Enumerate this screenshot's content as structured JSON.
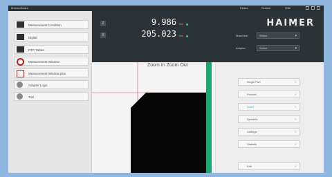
{
  "titlebar": {
    "title": "Messsoftware",
    "menus": [
      "Extras",
      "Service",
      "Hilfe"
    ]
  },
  "sidebar": {
    "items": [
      {
        "label": "Measurement Condition",
        "icon": "measurement-condition-icon"
      },
      {
        "label": "Digital",
        "icon": "digital-icon"
      },
      {
        "label": "RTC Tables",
        "icon": "rtc-tables-icon"
      },
      {
        "label": "Measurement Window",
        "icon": "measurement-window-icon"
      },
      {
        "label": "Measurement Window plus",
        "icon": "measurement-window-plus-icon"
      },
      {
        "label": "Adapter Logic",
        "icon": "adapter-logic-icon"
      },
      {
        "label": "Tool",
        "icon": "tool-icon"
      }
    ]
  },
  "readout": {
    "axes": [
      {
        "badge": "Z",
        "value": "9.986",
        "unit": "mm"
      },
      {
        "badge": "X",
        "value": "205.023",
        "unit": "mm"
      }
    ],
    "logo": "HAIMER",
    "fields": [
      {
        "label": "Maschine",
        "value": "Select"
      },
      {
        "label": "Adapter",
        "value": "Select"
      }
    ],
    "accent": "#2fcf8f"
  },
  "view": {
    "overlay_text": "Zoom In  Zoom Out",
    "crosshair_color": "#e37878",
    "tool_color": "#050505",
    "edge_color": "#1aa86f"
  },
  "right_panel": {
    "buttons": [
      {
        "label": "Single Part",
        "active": false
      },
      {
        "label": "Produkt",
        "active": false
      },
      {
        "label": "Insert",
        "active": true
      },
      {
        "label": "Spindeln",
        "active": false
      },
      {
        "label": "Settings",
        "active": false
      },
      {
        "label": "Statistik",
        "active": false
      }
    ],
    "bottom_button": "Edit"
  }
}
